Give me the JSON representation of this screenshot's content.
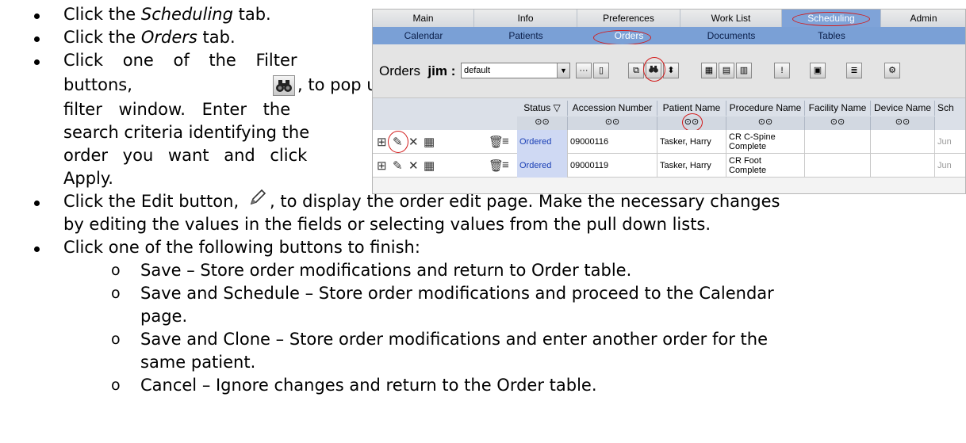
{
  "steps": {
    "s1_prefix": "Click the ",
    "s1_italic": "Scheduling",
    "s1_suffix": " tab.",
    "s2_prefix": "Click the ",
    "s2_italic": "Orders",
    "s2_suffix": " tab.",
    "s3_line1": "Click one of the Filter",
    "s3_line2": "buttons,",
    "s3_line2b": ", to pop up the",
    "s3_line3": "filter window. Enter the",
    "s3_line4": "search criteria identifying the",
    "s3_line5": "order you want and click",
    "s3_line6": "Apply.",
    "s4_line1a": "Click the Edit button,",
    "s4_line1b": ", to display the order edit page. Make the necessary changes",
    "s4_line2": "by editing the values in the fields or selecting values from the pull down lists.",
    "s5_line1": "Click one of the following buttons to finish:",
    "o1": "Save – Store order modifications and return to Order table.",
    "o2_line1": "Save and Schedule – Store order modifications and proceed to the Calendar",
    "o2_line2": "page.",
    "o3_line1": "Save and Clone – Store order modifications and enter another order for the",
    "o3_line2": "same patient.",
    "o4": "Cancel – Ignore changes and return to the Order table.",
    "sub_marker": "o"
  },
  "screenshot": {
    "main_tabs": [
      "Main",
      "Info",
      "Preferences",
      "Work List",
      "Scheduling",
      "Admin"
    ],
    "sub_tabs": [
      "Calendar",
      "Patients",
      "Orders",
      "Documents",
      "Tables"
    ],
    "toolbar": {
      "title": "Orders",
      "user": "jim :",
      "select_value": "default",
      "ellipsis_btn": "···"
    },
    "columns": [
      "Status ▽",
      "Accession Number",
      "Patient Name",
      "Procedure Name",
      "Facility Name",
      "Device Name",
      "Sch"
    ],
    "rows": [
      {
        "status": "Ordered",
        "accession": "09000116",
        "patient": "Tasker, Harry",
        "procedure_l1": "CR C-Spine",
        "procedure_l2": "Complete",
        "sched": "Jun"
      },
      {
        "status": "Ordered",
        "accession": "09000119",
        "patient": "Tasker, Harry",
        "procedure_l1": "CR Foot",
        "procedure_l2": "Complete",
        "sched": "Jun"
      }
    ]
  }
}
